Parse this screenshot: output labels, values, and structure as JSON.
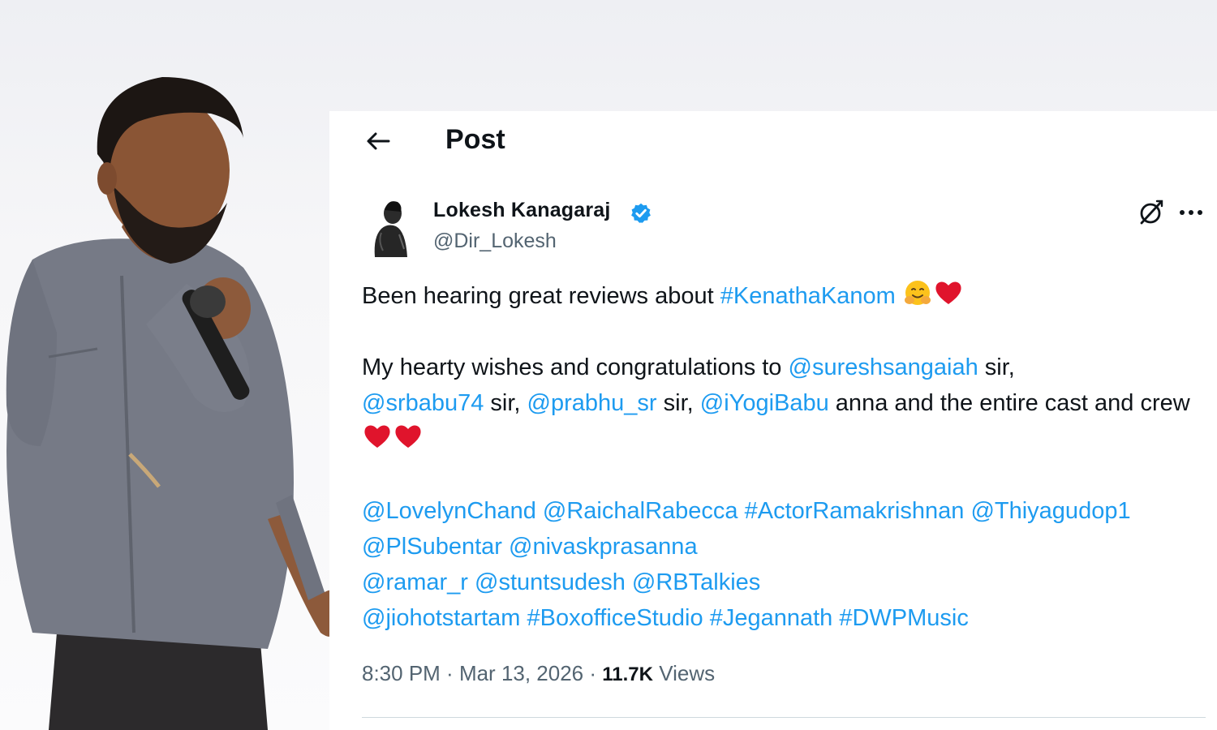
{
  "header": {
    "title": "Post"
  },
  "author": {
    "name": "Lokesh Kanagaraj",
    "handle": "@Dir_Lokesh"
  },
  "post": {
    "p1": {
      "text": "Been hearing great reviews about ",
      "hashtag": "#KenathaKanom"
    },
    "p2": {
      "t1": "My hearty wishes and congratulations to ",
      "m1": "@sureshsangaiah",
      "t2": " sir,",
      "m2": "@srbabu74",
      "t3": " sir, ",
      "m3": "@prabhu_sr",
      "t4": " sir, ",
      "m4": "@iYogiBabu",
      "t5": " anna and the entire cast and crew "
    },
    "tags": {
      "a": "@LovelynChand",
      "b": "@RaichalRabecca",
      "c": "#ActorRamakrishnan",
      "d": "@Thiyagudop1",
      "e": "@PlSubentar",
      "f": "@nivaskprasanna",
      "g": "@ramar_r",
      "h": "@stuntsudesh",
      "i": "@RBTalkies",
      "j": "@jiohotstartam",
      "k": "#BoxofficeStudio",
      "l": "#Jegannath",
      "m": "#DWPMusic"
    }
  },
  "meta": {
    "time": "8:30 PM",
    "sep": " · ",
    "date": "Mar 13, 2026",
    "views_count": "11.7K",
    "views_label": " Views"
  },
  "colors": {
    "link": "#1d9bf0",
    "verified": "#1d9bf0",
    "heart": "#e0142c",
    "text": "#0f1419",
    "muted": "#536471"
  },
  "icons": [
    "back-arrow-icon",
    "verified-badge-icon",
    "grok-icon",
    "more-dots-icon",
    "hugging-face-emoji-icon",
    "red-heart-emoji-icon"
  ]
}
